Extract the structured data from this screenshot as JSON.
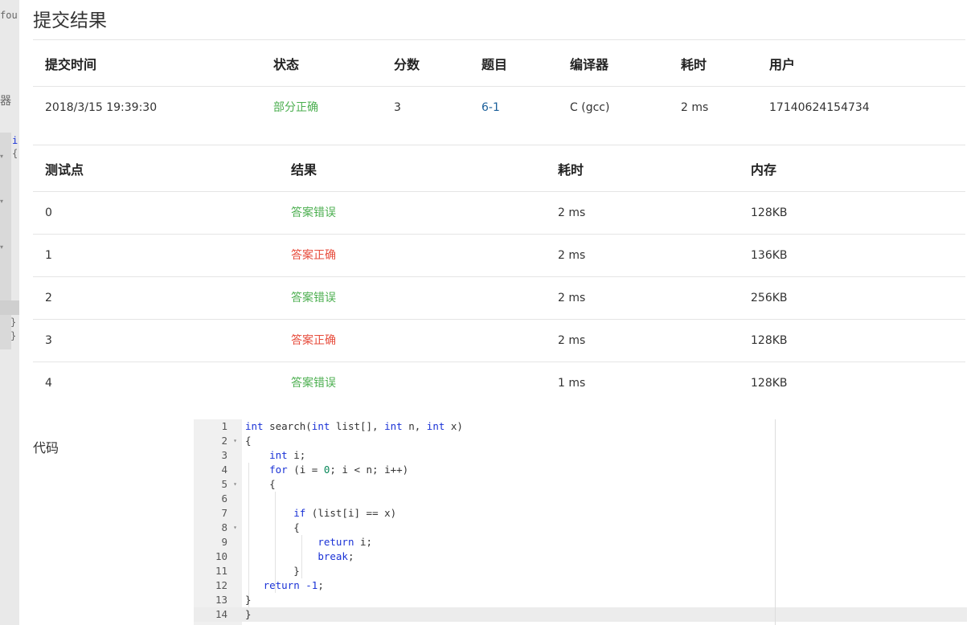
{
  "title": "提交结果",
  "submission": {
    "headers": [
      "提交时间",
      "状态",
      "分数",
      "题目",
      "编译器",
      "耗时",
      "用户"
    ],
    "values": [
      "2018/3/15 19:39:30",
      "部分正确",
      "3",
      "6-1",
      "C (gcc)",
      "2 ms",
      "17140624154734"
    ]
  },
  "tests": {
    "headers": [
      "测试点",
      "结果",
      "耗时",
      "内存"
    ],
    "rows": [
      [
        "0",
        "答案错误",
        "2 ms",
        "128KB"
      ],
      [
        "1",
        "答案正确",
        "2 ms",
        "136KB"
      ],
      [
        "2",
        "答案错误",
        "2 ms",
        "256KB"
      ],
      [
        "3",
        "答案正确",
        "2 ms",
        "128KB"
      ],
      [
        "4",
        "答案错误",
        "1 ms",
        "128KB"
      ]
    ]
  },
  "code_label": "代码",
  "code": {
    "line_numbers": [
      "1",
      "2",
      "3",
      "4",
      "5",
      "6",
      "7",
      "8",
      "9",
      "10",
      "11",
      "12",
      "13",
      "14"
    ],
    "lines": [
      "int search(int list[], int n, int x)",
      "{",
      "    int i;",
      "    for (i = 0; i < n; i++)",
      "    {",
      "",
      "        if (list[i] == x)",
      "        {",
      "            return i;",
      "            break;",
      "        }",
      "   return -1;",
      "}",
      "}"
    ]
  },
  "background": {
    "fragments": [
      "fou",
      "器",
      "i",
      "{",
      "}",
      "}"
    ]
  },
  "colors": {
    "accepted": "#e74c3c",
    "wrong": "#4caf50",
    "link": "#1a5f9a",
    "keyword": "#1a32d6"
  }
}
